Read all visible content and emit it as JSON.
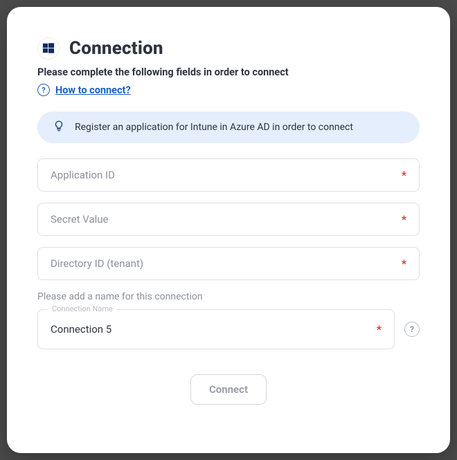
{
  "dialog": {
    "title": "Connection",
    "subtitle": "Please complete the following fields in order to connect",
    "help_link": "How to connect?",
    "info_banner": "Register an application for Intune in Azure AD in order to connect",
    "fields": {
      "application_id": {
        "placeholder": "Application ID",
        "value": ""
      },
      "secret_value": {
        "placeholder": "Secret Value",
        "value": ""
      },
      "directory_id": {
        "placeholder": "Directory ID (tenant)",
        "value": ""
      }
    },
    "connection_name_section_label": "Please add a name for this connection",
    "connection_name": {
      "label": "Connection Name",
      "value": "Connection 5"
    },
    "connect_button": "Connect"
  }
}
